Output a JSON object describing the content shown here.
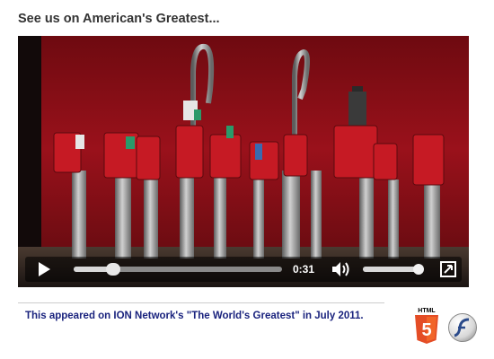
{
  "heading": "See us on American's Greatest...",
  "video": {
    "current_time": "0:31",
    "progress": 0.19,
    "volume": 1.0
  },
  "icons": {
    "play": "play-icon",
    "volume": "volume-icon",
    "fullscreen": "fullscreen-icon",
    "html5": "html5-logo-icon",
    "flash": "flash-logo-icon"
  },
  "badges": {
    "html5_text": "HTML",
    "html5_number": "5"
  },
  "caption": "This appeared on ION Network's \"The World's Greatest\" in July 2011.",
  "colors": {
    "backdrop": "#8b0d16",
    "caption": "#1a237e",
    "html5_orange": "#e44d26"
  }
}
